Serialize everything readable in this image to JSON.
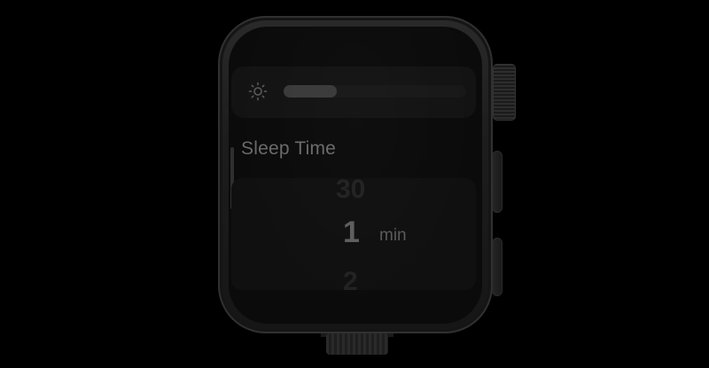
{
  "settings": {
    "brightness": {
      "icon": "sun-icon",
      "level": 0.29
    },
    "sleep_time": {
      "title": "Sleep Time",
      "picker": {
        "prev_value": "30",
        "current_value": "1",
        "unit": "min",
        "next_value": "2"
      }
    }
  },
  "colors": {
    "background": "#000000",
    "case": "#1c1c1c",
    "screen": "#0b0b0b",
    "text_dim": "#6a6a6a"
  }
}
